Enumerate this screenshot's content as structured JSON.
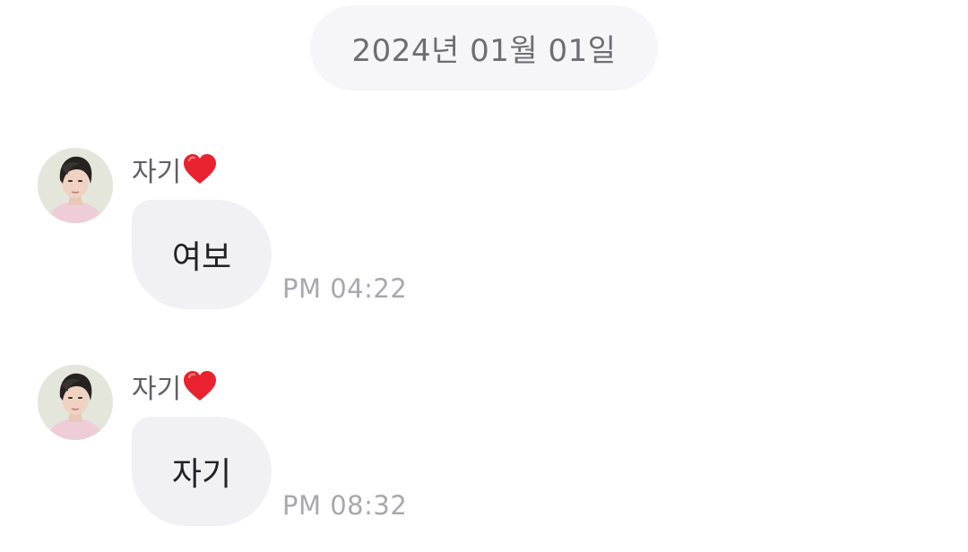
{
  "date_separator": "2024년 01월 01일",
  "messages": [
    {
      "sender": "자기",
      "sender_emoji": "red-heart-icon",
      "text": "여보",
      "time": "PM 04:22"
    },
    {
      "sender": "자기",
      "sender_emoji": "red-heart-icon",
      "text": "자기",
      "time": "PM 08:32"
    }
  ],
  "colors": {
    "background": "#ffffff",
    "date_pill": "#f6f6f8",
    "bubble": "#f1f1f4",
    "heart": "#e8232f",
    "timestamp": "#a8a8ae"
  }
}
